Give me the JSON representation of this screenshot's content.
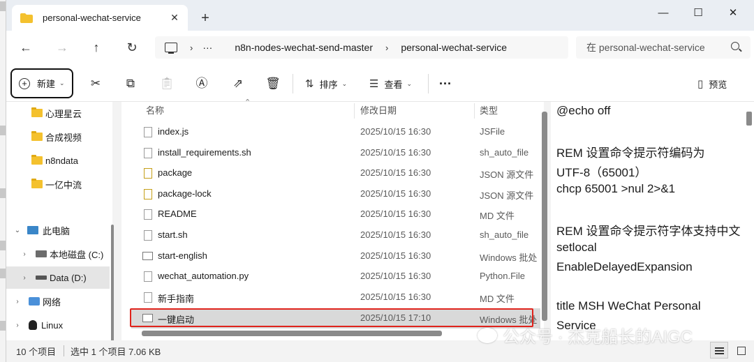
{
  "window": {
    "tab_title": "personal-wechat-service",
    "tab_close": "✕",
    "new_tab": "+",
    "minimize": "—",
    "maximize": "☐",
    "close": "✕"
  },
  "nav": {
    "back": "←",
    "forward": "→",
    "up": "↑",
    "refresh": "↻",
    "breadcrumb_overflow": "···",
    "crumbs": [
      "n8n-nodes-wechat-send-master",
      "personal-wechat-service"
    ],
    "search_placeholder": "在 personal-wechat-service"
  },
  "toolbar": {
    "new_label": "新建",
    "sort_label": "排序",
    "view_label": "查看",
    "more": "···",
    "preview_label": "预览"
  },
  "sidebar": {
    "items": [
      {
        "label": "心理星云",
        "icon": "folder-icon"
      },
      {
        "label": "合成视频",
        "icon": "folder-icon"
      },
      {
        "label": "n8ndata",
        "icon": "folder-icon"
      },
      {
        "label": "一亿中流",
        "icon": "folder-icon"
      },
      {
        "label": "此电脑",
        "icon": "computer-icon"
      },
      {
        "label": "本地磁盘 (C:)",
        "icon": "drive-icon"
      },
      {
        "label": "Data (D:)",
        "icon": "drive-icon"
      },
      {
        "label": "网络",
        "icon": "network-icon"
      },
      {
        "label": "Linux",
        "icon": "linux-icon"
      }
    ]
  },
  "files": {
    "columns": {
      "name": "名称",
      "date": "修改日期",
      "type": "类型"
    },
    "rows": [
      {
        "name": "index.js",
        "date": "2025/10/15 16:30",
        "type": "JSFile",
        "icon": "file-icon"
      },
      {
        "name": "install_requirements.sh",
        "date": "2025/10/15 16:30",
        "type": "sh_auto_file",
        "icon": "file-icon"
      },
      {
        "name": "package",
        "date": "2025/10/15 16:30",
        "type": "JSON 源文件",
        "icon": "json-icon"
      },
      {
        "name": "package-lock",
        "date": "2025/10/15 16:30",
        "type": "JSON 源文件",
        "icon": "json-icon"
      },
      {
        "name": "README",
        "date": "2025/10/15 16:30",
        "type": "MD 文件",
        "icon": "text-file-icon"
      },
      {
        "name": "start.sh",
        "date": "2025/10/15 16:30",
        "type": "sh_auto_file",
        "icon": "file-icon"
      },
      {
        "name": "start-english",
        "date": "2025/10/15 16:30",
        "type": "Windows 批处",
        "icon": "batch-icon"
      },
      {
        "name": "wechat_automation.py",
        "date": "2025/10/15 16:30",
        "type": "Python.File",
        "icon": "file-icon"
      },
      {
        "name": "新手指南",
        "date": "2025/10/15 16:30",
        "type": "MD 文件",
        "icon": "text-file-icon"
      },
      {
        "name": "一键启动",
        "date": "2025/10/15 17:10",
        "type": "Windows 批处",
        "icon": "batch-icon"
      }
    ]
  },
  "preview": {
    "lines": [
      "@echo off",
      "",
      "REM 设置命令提示符编码为",
      "UTF-8（65001）",
      "chcp 65001 >nul 2>&1",
      "",
      "REM 设置命令提示符字体支持中文",
      "setlocal",
      "EnableDelayedExpansion",
      "",
      "title MSH WeChat Personal",
      "Service"
    ]
  },
  "status": {
    "count": "10 个项目",
    "selection": "选中 1 个项目  7.06 KB"
  },
  "watermark": "公众号 · 杰克船长的AIGC",
  "colors": {
    "highlight_border": "#e0231c",
    "folder": "#f4c12e",
    "selected_row": "#d9d9d9"
  }
}
